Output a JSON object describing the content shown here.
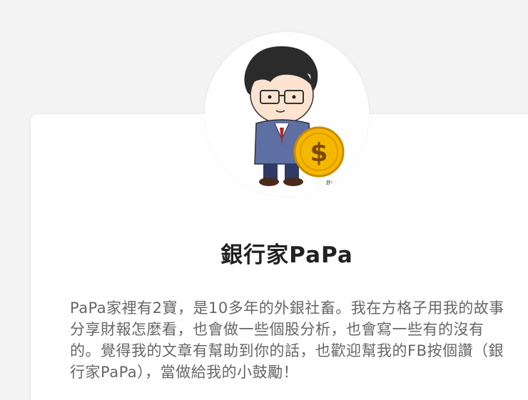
{
  "profile": {
    "name": "銀行家PaPa",
    "bio": "PaPa家裡有2寶，是10多年的外銀社畜。我在方格子用我的故事分享財報怎麼看，也會做一些個股分析，也會寫一些有的沒有的。覺得我的文章有幫助到你的話，也歡迎幫我的FB按個讚（銀行家PaPa），當做給我的小鼓勵！",
    "avatar_icon": "cartoon-banker-with-coin-icon",
    "avatar_signature": "By Sarah"
  },
  "colors": {
    "background": "#f3f3f3",
    "card": "#ffffff",
    "title": "#222222",
    "bio": "#666666",
    "coin": "#f5b800"
  }
}
